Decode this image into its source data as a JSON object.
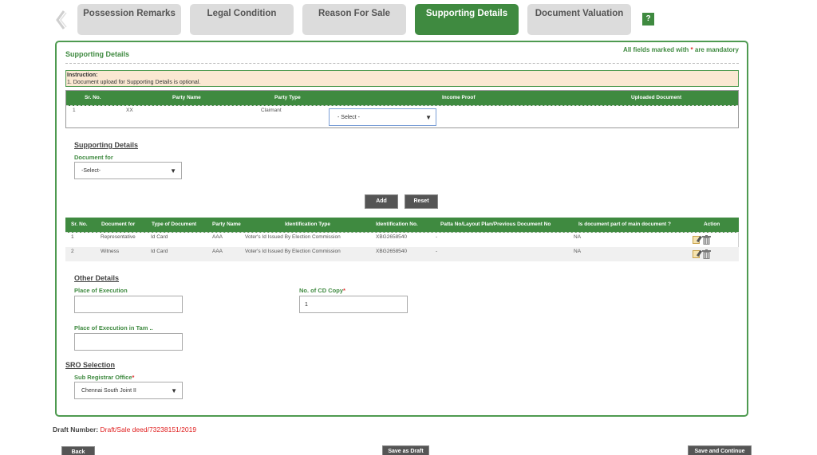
{
  "tabs": [
    {
      "label": "Possession Remarks",
      "active": false
    },
    {
      "label": "Legal Condition",
      "active": false
    },
    {
      "label": "Reason For Sale",
      "active": false
    },
    {
      "label": "Supporting Details",
      "active": true
    },
    {
      "label": "Document Valuation",
      "active": false
    }
  ],
  "help_label": "?",
  "panel": {
    "title": "Supporting Details",
    "mandatory_prefix": "All fields marked with ",
    "mandatory_star": "*",
    "mandatory_suffix": " are mandatory",
    "instruction_title": "Instruction:",
    "instruction_text": "1. Document upload for Supporting Details is optional."
  },
  "party_table": {
    "headers": [
      "Sr. No.",
      "Party Name",
      "Party Type",
      "Income Proof",
      "Uploaded Document"
    ],
    "rows": [
      {
        "sr": "1",
        "name": "XX",
        "type": "Claimant",
        "income_proof": "- Select -"
      }
    ]
  },
  "supporting": {
    "heading": "Supporting Details",
    "document_for_label": "Document for",
    "document_for_value": "-Select-",
    "add_label": "Add",
    "reset_label": "Reset"
  },
  "doc_table": {
    "headers": [
      "Sr. No.",
      "Document for",
      "Type of Document",
      "Party Name",
      "Identification Type",
      "Identification No.",
      "Patta No/Layout Plan/Previous Document No",
      "Is document part of main document ?",
      "Action"
    ],
    "rows": [
      {
        "sr": "1",
        "doc_for": "Representative",
        "doc_type": "Id Card",
        "party": "AAA",
        "id_type": "Voter's Id Issued By Election Commission",
        "id_no": "XBG2658540",
        "patta": "-",
        "part_of_main": "NA"
      },
      {
        "sr": "2",
        "doc_for": "Witness",
        "doc_type": "Id Card",
        "party": "AAA",
        "id_type": "Voter's Id Issued By Election Commission",
        "id_no": "XBG2658540",
        "patta": "-",
        "part_of_main": "NA"
      }
    ]
  },
  "other": {
    "heading": "Other Details",
    "place_label": "Place of Execution",
    "place_value": "",
    "place_tamil_label": "Place of Execution in Tam ..",
    "place_tamil_value": "",
    "cd_copy_label": "No. of CD Copy",
    "cd_copy_star": "*",
    "cd_copy_value": "1"
  },
  "sro": {
    "heading": "SRO Selection",
    "label": "Sub Registrar Office",
    "star": "*",
    "value": "Chennai South Joint II"
  },
  "footer": {
    "draft_label": "Draft Number:",
    "draft_value": "Draft/Sale deed/73238151/2019",
    "back_label": "Back",
    "save_draft_label": "Save as Draft",
    "save_continue_label": "Save and Continue"
  },
  "colors": {
    "accent": "#3f8a40",
    "tab_inactive": "#dcdcdc",
    "instruction_bg": "#fae8d2",
    "draft_number": "#e02020",
    "button": "#555555"
  }
}
